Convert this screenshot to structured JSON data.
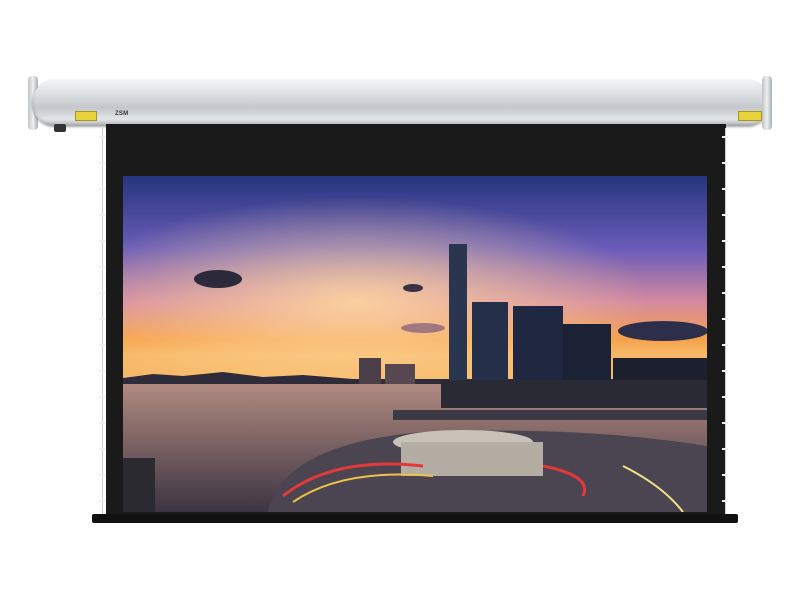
{
  "screen": {
    "brand_text": "ZSM",
    "colors": {
      "housing": "#d9dcdf",
      "cloth": "#1a1a1a",
      "label": "#e8d23a",
      "sky_top": "#2d3f8a",
      "sky_glow": "#f6a24a",
      "water": "#6e5a6a"
    }
  }
}
